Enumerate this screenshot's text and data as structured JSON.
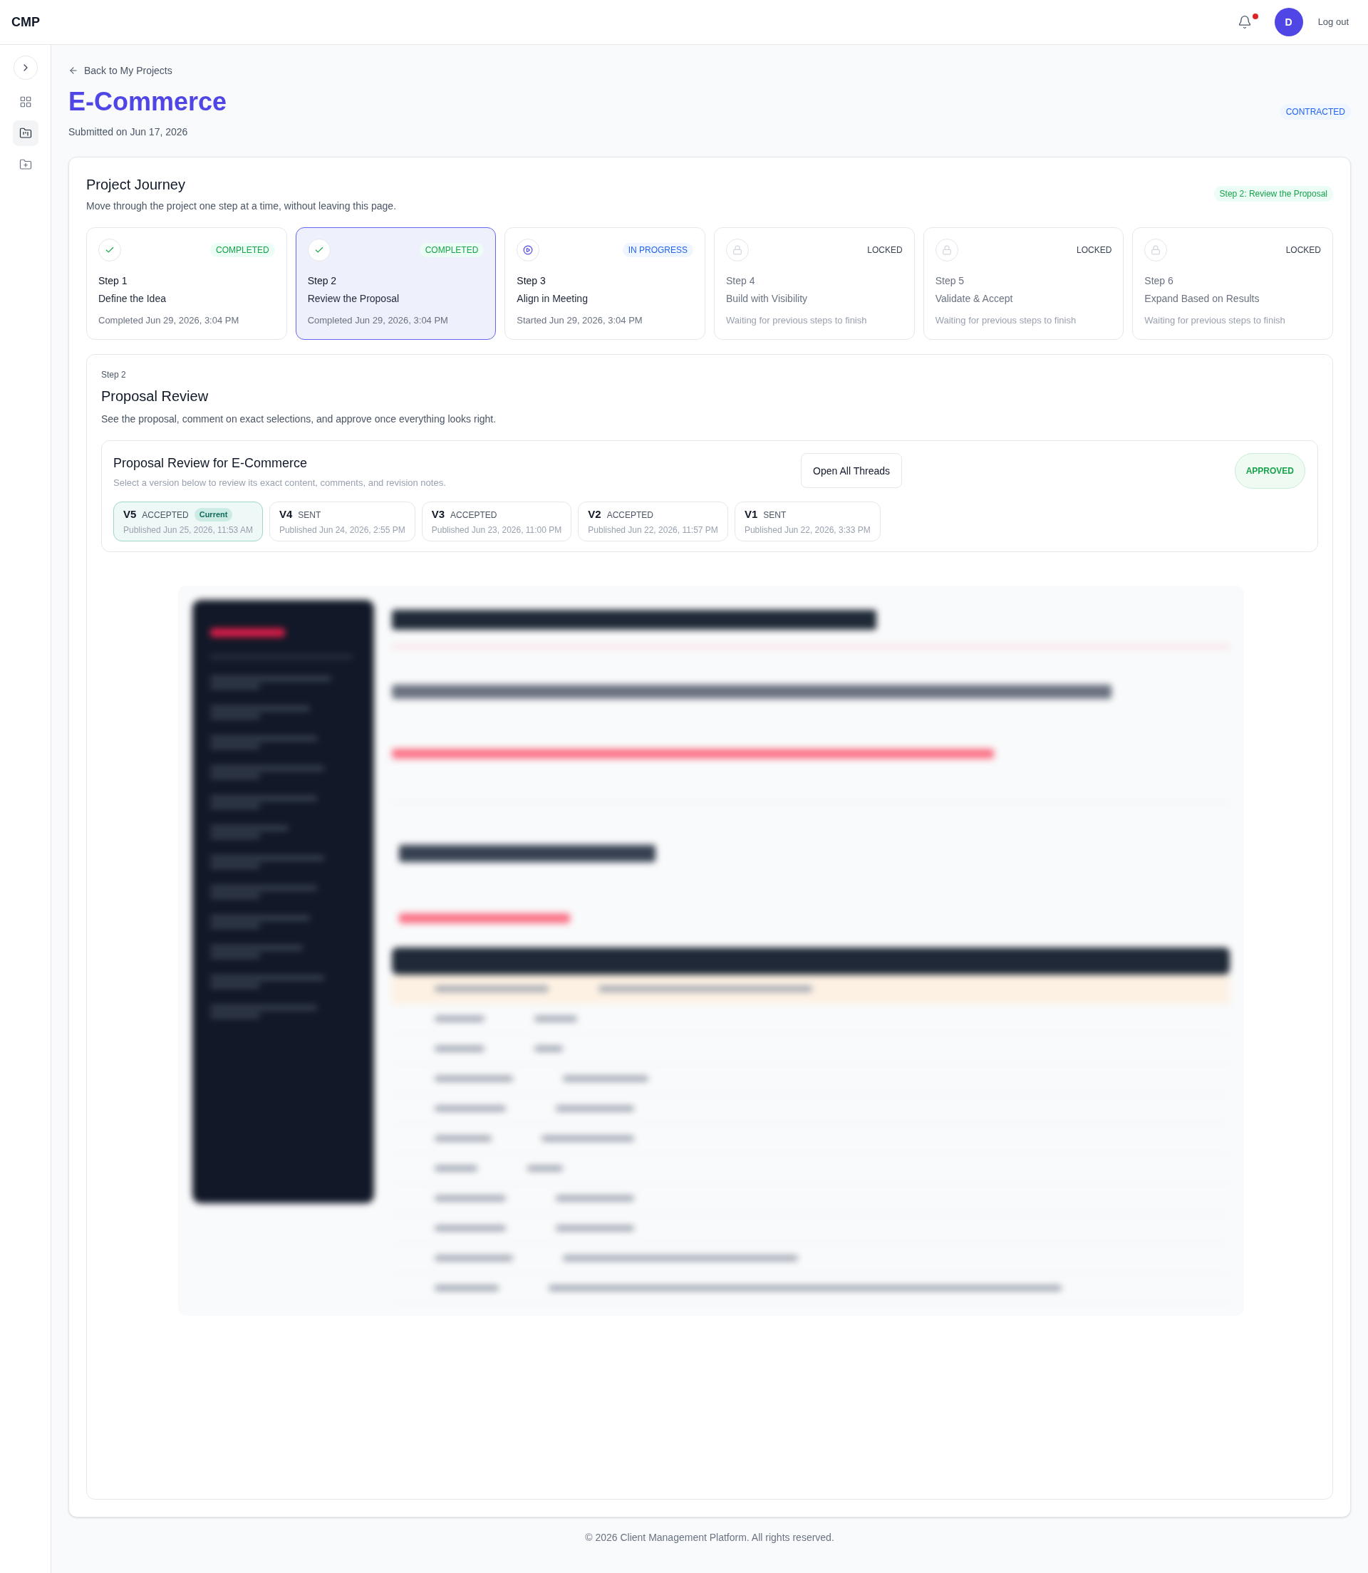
{
  "top_bar": {
    "logo": "CMP",
    "has_unread_notifications": true,
    "avatar_initial": "D",
    "logout": "Log out"
  },
  "sidebar": {
    "toggle": {
      "expanded": false
    },
    "items": [
      {
        "kind": "dashboard",
        "selected": false
      },
      {
        "kind": "projects",
        "selected": true
      },
      {
        "kind": "new_project",
        "selected": false
      }
    ]
  },
  "header": {
    "back_link": "Back to My Projects",
    "title": "E-Commerce",
    "submitted": "Submitted on Jun 17, 2026",
    "status": "CONTRACTED"
  },
  "journey": {
    "title": "Project Journey",
    "subtitle": "Move through the project one step at a time, without leaving this page.",
    "current_step": "Step 2: Review the Proposal",
    "steps": [
      {
        "step": "Step 1",
        "name": "Define the Idea",
        "kind": "completed",
        "status": "COMPLETED",
        "note": "Completed Jun 29, 2026, 3:04 PM",
        "selected": false
      },
      {
        "step": "Step 2",
        "name": "Review the Proposal",
        "kind": "completed",
        "status": "COMPLETED",
        "note": "Completed Jun 29, 2026, 3:04 PM",
        "selected": true
      },
      {
        "step": "Step 3",
        "name": "Align in Meeting",
        "kind": "in_progress",
        "status": "IN PROGRESS",
        "note": "Started Jun 29, 2026, 3:04 PM",
        "selected": false
      },
      {
        "step": "Step 4",
        "name": "Build with Visibility",
        "kind": "locked",
        "status": "LOCKED",
        "note": "Waiting for previous steps to finish",
        "selected": false
      },
      {
        "step": "Step 5",
        "name": "Validate & Accept",
        "kind": "locked",
        "status": "LOCKED",
        "note": "Waiting for previous steps to finish",
        "selected": false
      },
      {
        "step": "Step 6",
        "name": "Expand Based on Results",
        "kind": "locked",
        "status": "LOCKED",
        "note": "Waiting for previous steps to finish",
        "selected": false
      }
    ]
  },
  "step_panel": {
    "eyebrow": "Step 2",
    "title": "Proposal Review",
    "description": "See the proposal, comment on exact selections, and approve once everything looks right.",
    "review": {
      "title": "Proposal Review for E-Commerce",
      "subtitle": "Select a version below to review its exact content, comments, and revision notes.",
      "open_threads": "Open All Threads",
      "status": "APPROVED",
      "versions": [
        {
          "version": "V5",
          "status": "ACCEPTED",
          "current": "Current",
          "published": "Published Jun 25, 2026, 11:53 AM",
          "selected": true
        },
        {
          "version": "V4",
          "status": "SENT",
          "published": "Published Jun 24, 2026, 2:55 PM",
          "selected": false
        },
        {
          "version": "V3",
          "status": "ACCEPTED",
          "published": "Published Jun 23, 2026, 11:00 PM",
          "selected": false
        },
        {
          "version": "V2",
          "status": "ACCEPTED",
          "published": "Published Jun 22, 2026, 11:57 PM",
          "selected": false
        },
        {
          "version": "V1",
          "status": "SENT",
          "published": "Published Jun 22, 2026, 3:33 PM",
          "selected": false
        }
      ]
    }
  },
  "footer": {
    "text": "© 2026 Client Management Platform. All rights reserved."
  }
}
